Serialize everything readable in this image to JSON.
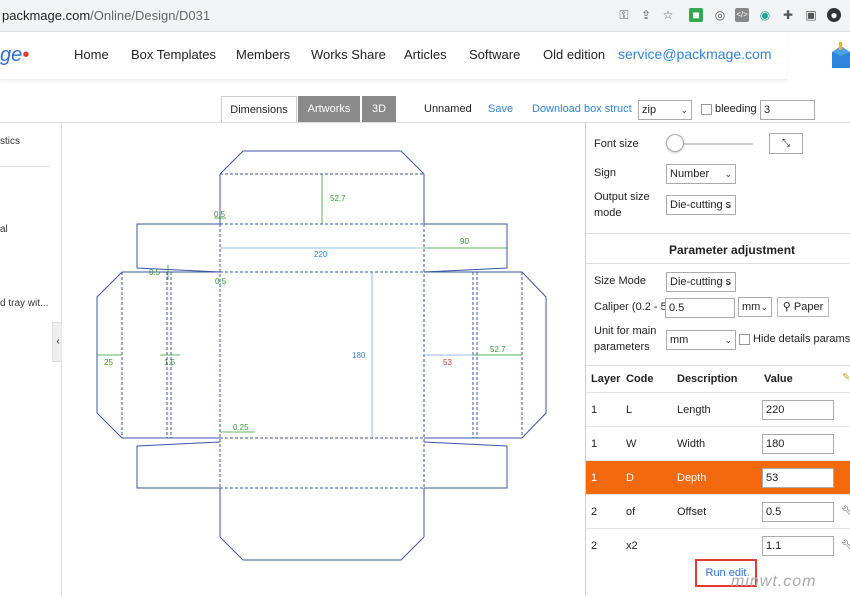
{
  "browser": {
    "url_host": "packmage.com",
    "url_path": "/Online/Design/D031",
    "icons": [
      "key-icon",
      "share-icon",
      "star-icon",
      "extension-icon",
      "puzzle-icon",
      "sidebar-icon",
      "profile-icon"
    ]
  },
  "site": {
    "logo_text": "ge",
    "nav": [
      "Home",
      "Box Templates",
      "Members",
      "Works Share",
      "Articles",
      "Software",
      "Old edition"
    ],
    "email": "service@packmage.com"
  },
  "toolbar": {
    "tabs": [
      "Dimensions",
      "Artworks",
      "3D"
    ],
    "name": "Unnamed",
    "save": "Save",
    "download": "Download box struct",
    "format": "zip",
    "bleeding_label": "bleeding",
    "bleeding_value": "3"
  },
  "left_panel": {
    "items": [
      "stics",
      "al",
      "d tray wit..."
    ]
  },
  "dieline": {
    "labels": {
      "top_flap": "52.7",
      "top_small": "0.5",
      "length": "220",
      "side_flap_w": "90",
      "left_small1": "0.5",
      "left_small2": "0.5",
      "width": "180",
      "left_25": "25",
      "left_15": "1.5",
      "depth_red": "53",
      "right_flap": "52.7",
      "bottom_small": "0.25"
    }
  },
  "right_panel": {
    "font_size_label": "Font size",
    "sign_label": "Sign",
    "sign_value": "Number",
    "output_label_1": "Output size",
    "output_label_2": "mode",
    "output_value": "Die-cutting s",
    "param_title": "Parameter adjustment",
    "size_mode_label": "Size Mode",
    "size_mode_value": "Die-cutting s",
    "caliper_label": "Caliper (0.2 - 5)",
    "caliper_value": "0.5",
    "caliper_unit": "mm",
    "paper_label": "Paper",
    "unit_label_1": "Unit for main",
    "unit_label_2": "parameters",
    "unit_value": "mm",
    "hide_details": "Hide details params",
    "table_headers": [
      "Layer",
      "Code",
      "Description",
      "Value"
    ],
    "rows": [
      {
        "layer": "1",
        "code": "L",
        "desc": "Length",
        "value": "220"
      },
      {
        "layer": "1",
        "code": "W",
        "desc": "Width",
        "value": "180"
      },
      {
        "layer": "1",
        "code": "D",
        "desc": "Depth",
        "value": "53"
      },
      {
        "layer": "2",
        "code": "of",
        "desc": "Offset",
        "value": "0.5"
      },
      {
        "layer": "2",
        "code": "x2",
        "desc": "",
        "value": "1.1"
      }
    ],
    "run_edit": "Run edit"
  },
  "watermark": "minwt.com",
  "colors": {
    "accent": "#2f84db",
    "highlight_row": "#f26a0d",
    "dieline_blue": "#3b57a6",
    "dim_green": "#2e9a2e",
    "dim_blue": "#2f84db",
    "dim_red": "#e53935"
  }
}
